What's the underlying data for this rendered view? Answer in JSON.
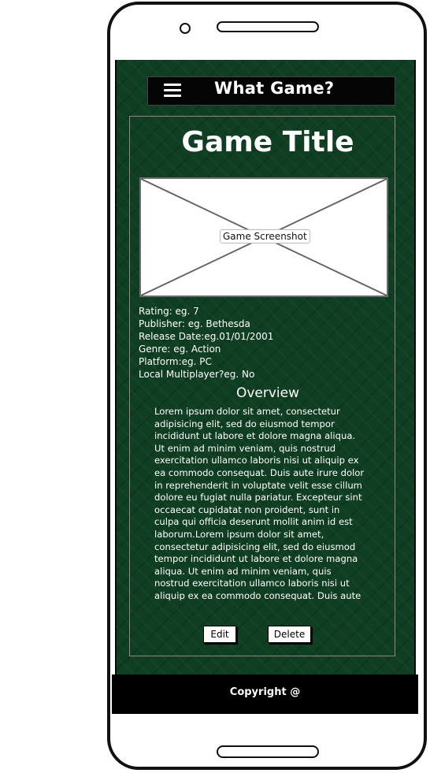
{
  "app": {
    "title": "What Game?"
  },
  "game": {
    "title": "Game Title",
    "screenshot_label": "Game Screenshot",
    "details": [
      "Rating: eg. 7",
      "Publisher: eg. Bethesda",
      "Release Date:eg.01/01/2001",
      "Genre: eg. Action",
      "Platform:eg. PC",
      "Local Multiplayer?eg. No"
    ],
    "overview_heading": "Overview",
    "overview_text": "Lorem ipsum dolor sit amet, consectetur adipisicing elit, sed do eiusmod tempor incididunt ut labore et dolore magna aliqua. Ut enim ad minim veniam, quis nostrud exercitation ullamco laboris nisi ut aliquip ex ea commodo consequat. Duis aute irure dolor in reprehenderit in voluptate velit esse cillum dolore eu fugiat nulla pariatur. Excepteur sint occaecat cupidatat non proident, sunt in culpa qui officia deserunt mollit anim id est laborum.Lorem ipsum dolor sit amet, consectetur adipisicing elit, sed do eiusmod tempor incididunt ut labore et dolore magna aliqua. Ut enim ad minim veniam, quis nostrud exercitation ullamco laboris nisi ut aliquip ex ea commodo consequat. Duis aute"
  },
  "actions": {
    "edit_label": "Edit",
    "delete_label": "Delete"
  },
  "footer": {
    "copyright": "Copyright @"
  }
}
